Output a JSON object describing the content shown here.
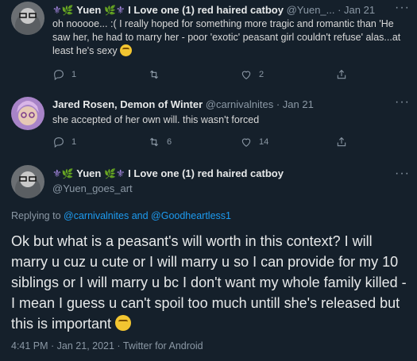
{
  "tweet1": {
    "name": "Yuen",
    "name_suffix": "I Love one (1) red haired catboy",
    "handle": "@Yuen_...",
    "date": "· Jan 21",
    "text": "oh nooooe... :( I really hoped for something more tragic and romantic than 'He saw her, he had to marry her - poor 'exotic' peasant girl couldn't refuse' alas...at least he's sexy",
    "reply_count": "1",
    "retweet_count": "",
    "like_count": "2"
  },
  "tweet2": {
    "name": "Jared Rosen, Demon of Winter",
    "handle": "@carnivalnites",
    "date": "· Jan 21",
    "text": "she accepted of her own will. this wasn't forced",
    "reply_count": "1",
    "retweet_count": "6",
    "like_count": "14"
  },
  "main_tweet": {
    "name": "Yuen",
    "name_suffix": "I Love one (1) red haired catboy",
    "handle": "@Yuen_goes_art",
    "replying_prefix": "Replying to",
    "replying_user1": "@carnivalnites",
    "replying_and": "and",
    "replying_user2": "@Goodheartless1",
    "text": "Ok but what is a peasant's will worth in this context? I will marry u cuz u cute or I will marry u so I can provide for my 10 siblings or I will marry u bc I don't want my whole family killed - I mean I guess u can't spoil too much untill she's released but this is important",
    "timestamp": "4:41 PM · Jan 21, 2021 · Twitter for Android"
  },
  "icons": [
    "more-icon",
    "reply-icon",
    "retweet-icon",
    "like-icon",
    "share-icon",
    "emoji-icon"
  ]
}
